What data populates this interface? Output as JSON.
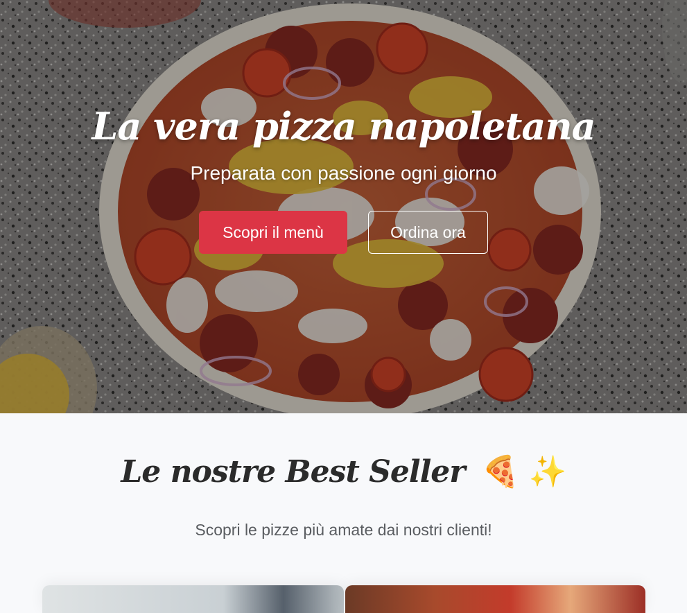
{
  "hero": {
    "title": "La vera pizza napoletana",
    "subtitle": "Preparata con passione ogni giorno",
    "primary_button": "Scopri il menù",
    "secondary_button": "Ordina ora",
    "colors": {
      "primary": "#dc3545",
      "text": "#ffffff"
    },
    "background_icon": "pizza-photo"
  },
  "bestseller": {
    "title": "Le nostre Best Seller",
    "title_emojis": "🍕 ✨",
    "subtitle": "Scopri le pizze più amate dai nostri clienti!",
    "cards": [
      {
        "icon": "pizza-photo-card"
      },
      {
        "icon": "pizza-photo-card"
      }
    ]
  }
}
